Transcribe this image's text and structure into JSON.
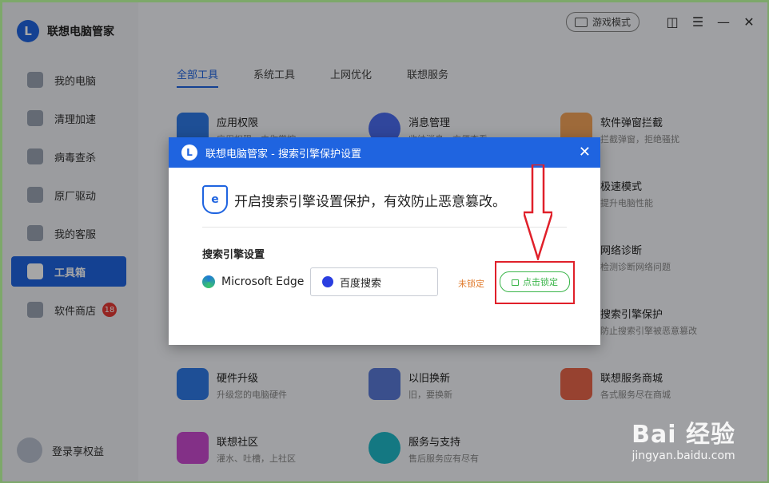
{
  "app": {
    "name": "联想电脑管家",
    "logo_letter": "L"
  },
  "sidebar": {
    "items": [
      {
        "label": "我的电脑"
      },
      {
        "label": "清理加速"
      },
      {
        "label": "病毒查杀"
      },
      {
        "label": "原厂驱动"
      },
      {
        "label": "我的客服"
      },
      {
        "label": "工具箱",
        "active": true
      },
      {
        "label": "软件商店",
        "badge": "18"
      }
    ],
    "user_label": "登录享权益"
  },
  "topbar": {
    "game_mode": "游戏模式"
  },
  "tabs": [
    {
      "label": "全部工具"
    },
    {
      "label": "系统工具"
    },
    {
      "label": "上网优化"
    },
    {
      "label": "联想服务"
    }
  ],
  "tools": [
    {
      "name": "应用权限",
      "desc": "应用权限，由你掌控"
    },
    {
      "name": "消息管理",
      "desc": "收纳消息，方便查看"
    },
    {
      "name": "软件弹窗拦截",
      "desc": "拦截弹窗，拒绝骚扰"
    },
    {
      "name": "极速模式",
      "desc": "提升电脑性能"
    },
    {
      "name": "网络诊断",
      "desc": "检测诊断网络问题"
    },
    {
      "name": "搜索引擎保护",
      "desc": "防止搜索引擎被恶意篡改"
    },
    {
      "name": "硬件升级",
      "desc": "升级您的电脑硬件"
    },
    {
      "name": "以旧换新",
      "desc": "旧，要换新"
    },
    {
      "name": "联想服务商城",
      "desc": "各式服务尽在商城"
    },
    {
      "name": "联想社区",
      "desc": "灌水、吐槽，上社区"
    },
    {
      "name": "服务与支持",
      "desc": "售后服务应有尽有"
    }
  ],
  "dialog": {
    "title": "联想电脑管家 - 搜索引擎保护设置",
    "headline": "开启搜索引擎设置保护，有效防止恶意篡改。",
    "section_label": "搜索引擎设置",
    "browser": "Microsoft Edge",
    "engine": "百度搜索",
    "status": "未锁定",
    "lock_button": "点击锁定",
    "shield_letter": "e"
  },
  "watermark": {
    "brand": "Bai 经验",
    "url": "jingyan.baidu.com"
  },
  "colors": {
    "accent": "#1f64e0",
    "warning": "#e07b2d",
    "success": "#3bb54a",
    "highlight": "#e0202a"
  }
}
